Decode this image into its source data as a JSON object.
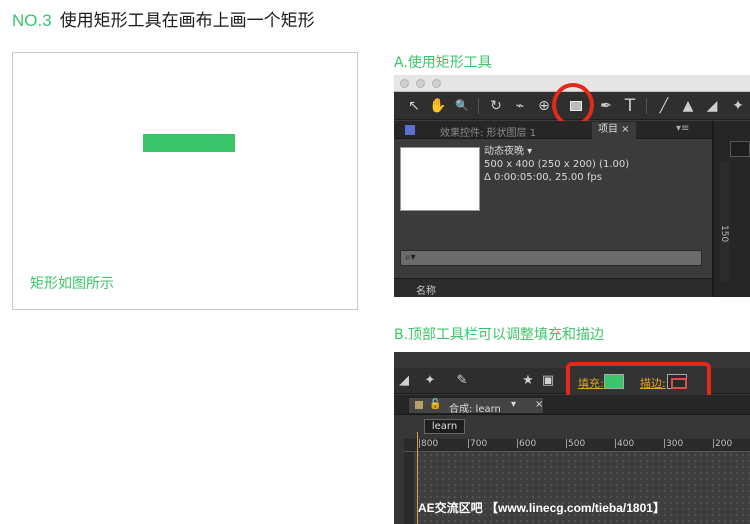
{
  "header": {
    "number": "NO.3",
    "title": "使用矩形工具在画布上画一个矩形"
  },
  "demo": {
    "caption": "矩形如图所示",
    "rect_color": "#3cc46a"
  },
  "section_a": {
    "label": "A.使用矩形工具",
    "tabs": {
      "effects": "效果控件: 形状图层 1",
      "project": "项目 ×",
      "menu": "▾≡"
    },
    "comp_info": {
      "name": "动态夜晚 ▾",
      "size": "500 x 400  (250 x 200) (1.00)",
      "duration": "Δ 0:00:05:00, 25.00 fps"
    },
    "search_icon": "⌕▾",
    "column_name": "名称",
    "ruler_text": "150",
    "tools": {
      "select": "↖",
      "hand": "✋",
      "zoom": "🔍",
      "rotate": "↻",
      "camera": "⌁",
      "pan": "⊕",
      "pen": "✒",
      "text": "T",
      "brush": "╱",
      "stamp": "▲",
      "eraser": "◢",
      "puppet": "✦"
    }
  },
  "section_b": {
    "label": "B.顶部工具栏可以调整填充和描边",
    "fill_label": "填充:",
    "stroke_label": "描边:",
    "fill_color": "#3cc46a",
    "comp_tab": "合成: learn",
    "comp_tab_dropdown": "▾",
    "comp_tab_close": "×",
    "learn_button": "learn",
    "ruler_ticks": [
      "800",
      "700",
      "600",
      "500",
      "400",
      "300",
      "200"
    ],
    "watermark": "AE交流区吧 【www.linecg.com/tieba/1801】",
    "tools": {
      "eraser": "◢",
      "puppet": "✦",
      "pin": "✎",
      "star": "★",
      "mask": "▣"
    }
  }
}
